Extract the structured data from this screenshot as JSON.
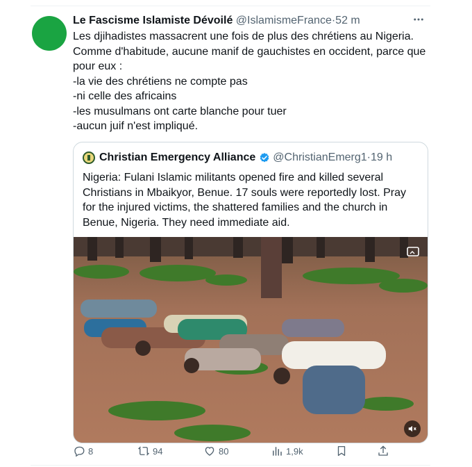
{
  "tweet": {
    "author_name": "Le Fascisme Islamiste Dévoilé",
    "author_handle": "@IslamismeFrance",
    "separator": "·",
    "time": "52 m",
    "avatar_color": "#1aa442",
    "lines": [
      "Les djihadistes massacrent une fois de plus des chrétiens au Nigeria.",
      "Comme d'habitude, aucune manif de gauchistes en occident, parce que",
      "pour eux :",
      "-la vie des chrétiens ne compte pas",
      "-ni celle des africains",
      "-les musulmans ont carte blanche pour tuer",
      "-aucun juif n'est impliqué."
    ]
  },
  "quote": {
    "author_name": "Christian Emergency Alliance",
    "author_handle": "@ChristianEmerg1",
    "separator": "·",
    "time": "19 h",
    "verified_color": "#1d9bf0",
    "lines": [
      "Nigeria: Fulani Islamic militants opened fire and killed several",
      "Christians in Mbaikyor, Benue. 17 souls were reportedly lost. Pray",
      "for the injured victims, the shattered families and the church in",
      "Benue, Nigeria. They need immediate aid."
    ]
  },
  "actions": {
    "replies": "8",
    "retweets": "94",
    "likes": "80",
    "views": "1,9k"
  },
  "icons": {
    "reply": "reply-icon",
    "retweet": "retweet-icon",
    "like": "heart-icon",
    "views": "views-icon",
    "bookmark": "bookmark-icon",
    "share": "share-icon",
    "mute": "mute-icon",
    "more": "more-icon"
  },
  "colors": {
    "text": "#0f1419",
    "secondary": "#536471",
    "border": "#cfd9de"
  }
}
